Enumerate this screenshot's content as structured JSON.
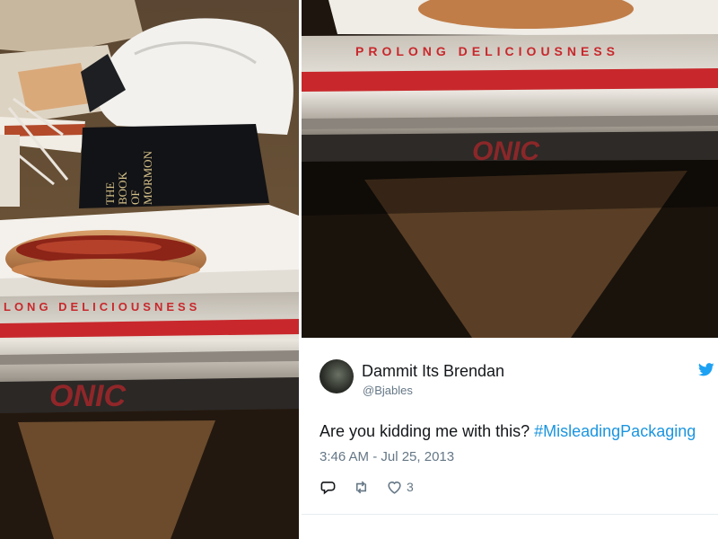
{
  "left_photo": {
    "book_title_lines": [
      "THE",
      "BOOK",
      "OF",
      "MORMON"
    ],
    "package_text": "LONG   DELICIOUSNESS"
  },
  "right_photo": {
    "package_text": "PROLONG   DELICIOUSNESS"
  },
  "tweet": {
    "author_name": "Dammit Its Brendan",
    "author_handle": "@Bjables",
    "text_plain": "Are you kidding me with this? ",
    "hashtag": "#MisleadingPackaging",
    "timestamp": "3:46 AM - Jul 25, 2013",
    "like_count": "3",
    "icons": [
      "twitter-bird-icon",
      "reply-icon",
      "retweet-icon",
      "like-icon"
    ],
    "colors": {
      "hashtag": "#1b95e0",
      "bird": "#1da1f2",
      "package_red": "#c8282c"
    }
  }
}
